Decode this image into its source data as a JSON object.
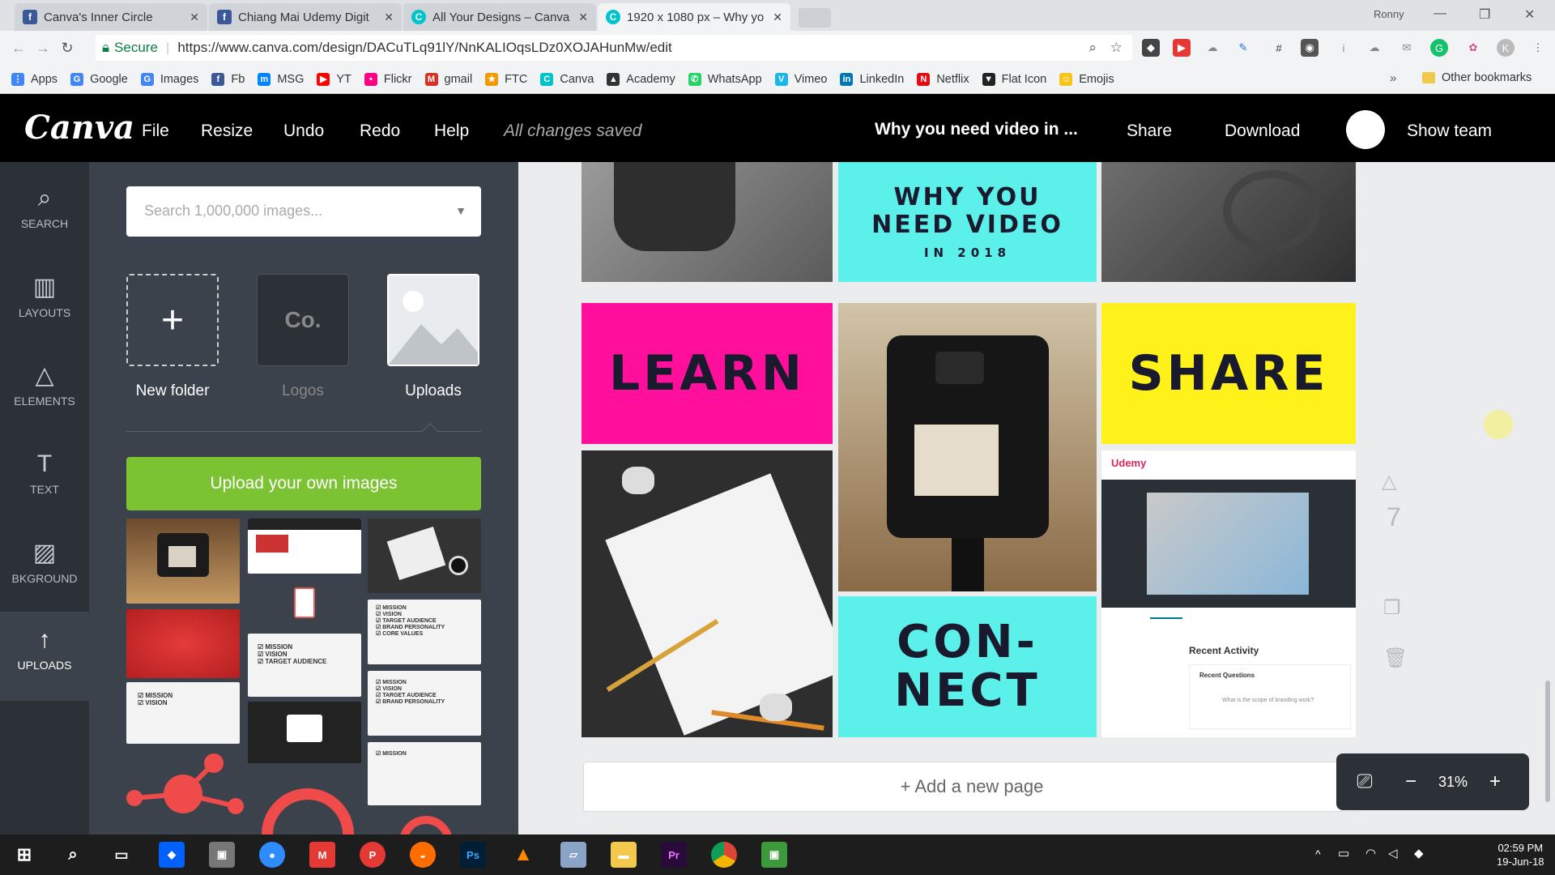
{
  "browser": {
    "tabs": [
      {
        "title": "Canva's Inner Circle",
        "icon": "facebook-icon",
        "color": "#3b5998",
        "glyph": "f"
      },
      {
        "title": "Chiang Mai Udemy Digit",
        "icon": "facebook-icon",
        "color": "#3b5998",
        "glyph": "f"
      },
      {
        "title": "All Your Designs – Canva",
        "icon": "canva-icon",
        "color": "#00c4cc",
        "glyph": "C"
      },
      {
        "title": "1920 x 1080 px – Why yo",
        "icon": "canva-icon",
        "color": "#00c4cc",
        "glyph": "C"
      }
    ],
    "user": "Ronny",
    "security_label": "Secure",
    "url": "https://www.canva.com/design/DACuTLq91lY/NnKALIOqsLDz0XOJAHunMw/edit",
    "bookmarks": [
      {
        "label": "Apps",
        "color": "#4285f4",
        "glyph": "⋮"
      },
      {
        "label": "Google",
        "color": "#4285f4",
        "glyph": "G"
      },
      {
        "label": "Images",
        "color": "#4285f4",
        "glyph": "G"
      },
      {
        "label": "Fb",
        "color": "#3b5998",
        "glyph": "f"
      },
      {
        "label": "MSG",
        "color": "#0084ff",
        "glyph": "m"
      },
      {
        "label": "YT",
        "color": "#ff0000",
        "glyph": "▶"
      },
      {
        "label": "Flickr",
        "color": "#ff0084",
        "glyph": "•"
      },
      {
        "label": "gmail",
        "color": "#d93025",
        "glyph": "M"
      },
      {
        "label": "FTC",
        "color": "#f29900",
        "glyph": "★"
      },
      {
        "label": "Canva",
        "color": "#00c4cc",
        "glyph": "C"
      },
      {
        "label": "Academy",
        "color": "#333333",
        "glyph": "▲"
      },
      {
        "label": "WhatsApp",
        "color": "#25d366",
        "glyph": "✆"
      },
      {
        "label": "Vimeo",
        "color": "#1ab7ea",
        "glyph": "V"
      },
      {
        "label": "LinkedIn",
        "color": "#0077b5",
        "glyph": "in"
      },
      {
        "label": "Netflix",
        "color": "#e50914",
        "glyph": "N"
      },
      {
        "label": "Flat Icon",
        "color": "#222222",
        "glyph": "▼"
      },
      {
        "label": "Emojis",
        "color": "#f5c518",
        "glyph": "☺"
      }
    ],
    "more_bookmarks": "»",
    "other_bookmarks": "Other bookmarks"
  },
  "editor": {
    "logo": "Canva",
    "menu": [
      "File",
      "Resize",
      "Undo",
      "Redo",
      "Help"
    ],
    "save_status": "All changes saved",
    "design_title": "Why you need video in ...",
    "share_label": "Share",
    "download_label": "Download",
    "show_team_label": "Show team"
  },
  "rail": [
    {
      "label": "SEARCH",
      "icon": "search-icon",
      "glyph": "⌕"
    },
    {
      "label": "LAYOUTS",
      "icon": "layouts-icon",
      "glyph": "▥"
    },
    {
      "label": "ELEMENTS",
      "icon": "elements-icon",
      "glyph": "△"
    },
    {
      "label": "TEXT",
      "icon": "text-icon",
      "glyph": "T"
    },
    {
      "label": "BKGROUND",
      "icon": "background-icon",
      "glyph": "▨"
    },
    {
      "label": "UPLOADS",
      "icon": "upload-icon",
      "glyph": "↑"
    }
  ],
  "panel": {
    "search_placeholder": "Search 1,000,000 images...",
    "folders": [
      {
        "label": "New folder",
        "glyph": "+"
      },
      {
        "label": "Logos",
        "glyph": "Co."
      },
      {
        "label": "Uploads",
        "glyph": ""
      }
    ],
    "upload_button": "Upload your own images",
    "thumb_texts": {
      "t_mission_vision": "☑ MISSION\n☑ VISION",
      "t_mission_target": "☑ MISSION\n☑ VISION\n☑ TARGET AUDIENCE",
      "t_full": "☑ MISSION\n☑ VISION\n☑ TARGET AUDIENCE\n☑ BRAND PERSONALITY\n☑ CORE VALUES",
      "t_four": "☑ MISSION\n☑ VISION\n☑ TARGET AUDIENCE\n☑ BRAND PERSONALITY",
      "t_one": "☑ MISSION"
    }
  },
  "canvas": {
    "headline_line1": "WHY YOU",
    "headline_line2": "NEED VIDEO",
    "headline_line3": "IN 2018",
    "learn": "LEARN",
    "share": "SHARE",
    "connect_line1": "CON-",
    "connect_line2": "NECT",
    "udemy": {
      "brand": "Udemy",
      "recent_activity": "Recent Activity",
      "recent_questions": "Recent Questions",
      "question": "What is the scope of branding work?"
    },
    "colors": {
      "cyan": "#5cf0ea",
      "pink": "#ff0f9b",
      "yellow": "#fff21a"
    },
    "page_number": "7",
    "add_page": "+ Add a new page",
    "zoom_level": "31%"
  },
  "taskbar": {
    "time": "02:59 PM",
    "date": "19-Jun-18"
  }
}
